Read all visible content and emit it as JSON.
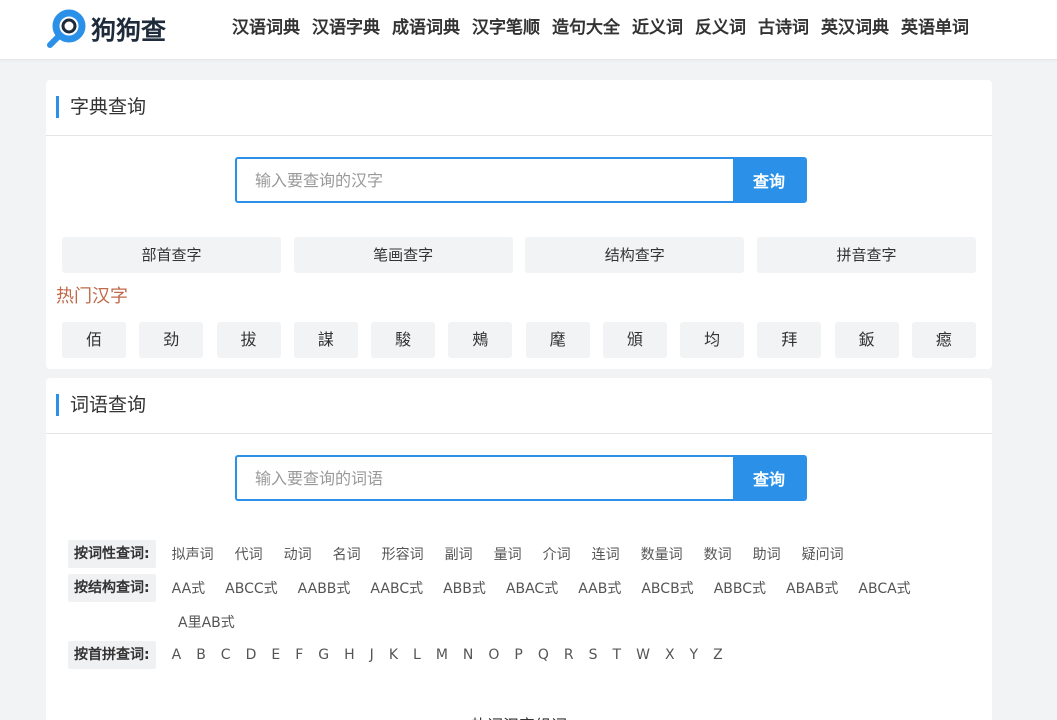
{
  "header": {
    "logo_text": "狗狗查",
    "nav": [
      "汉语词典",
      "汉语字典",
      "成语词典",
      "汉字笔顺",
      "造句大全",
      "近义词",
      "反义词",
      "古诗词",
      "英汉词典",
      "英语单词"
    ]
  },
  "dict": {
    "title": "字典查询",
    "placeholder": "输入要查询的汉字",
    "button": "查询",
    "modes": [
      "部首查字",
      "笔画查字",
      "结构查字",
      "拼音查字"
    ],
    "hot_title": "热门汉字",
    "hot_chars": [
      "佰",
      "劲",
      "拔",
      "謀",
      "駿",
      "鵊",
      "麾",
      "頒",
      "均",
      "拜",
      "鈑",
      "癋"
    ]
  },
  "words": {
    "title": "词语查询",
    "placeholder": "输入要查询的词语",
    "button": "查询",
    "pos_label": "按词性查词:",
    "pos_items": [
      "拟声词",
      "代词",
      "动词",
      "名词",
      "形容词",
      "副词",
      "量词",
      "介词",
      "连词",
      "数量词",
      "数词",
      "助词",
      "疑问词"
    ],
    "struct_label": "按结构查词:",
    "struct_items": [
      "AA式",
      "ABCC式",
      "AABB式",
      "AABC式",
      "ABB式",
      "ABAC式",
      "AAB式",
      "ABCB式",
      "ABBC式",
      "ABAB式",
      "ABCA式"
    ],
    "struct_extra": "A里AB式",
    "pinyin_label": "按首拼查词:",
    "pinyin_items": [
      "A",
      "B",
      "C",
      "D",
      "E",
      "F",
      "G",
      "H",
      "J",
      "K",
      "L",
      "M",
      "N",
      "O",
      "P",
      "Q",
      "R",
      "S",
      "T",
      "W",
      "X",
      "Y",
      "Z"
    ],
    "hot_words_title": "热词汉字组词"
  },
  "colors": {
    "accent": "#2b91e8",
    "hot_title": "#c0694a",
    "background": "#f2f3f5"
  }
}
